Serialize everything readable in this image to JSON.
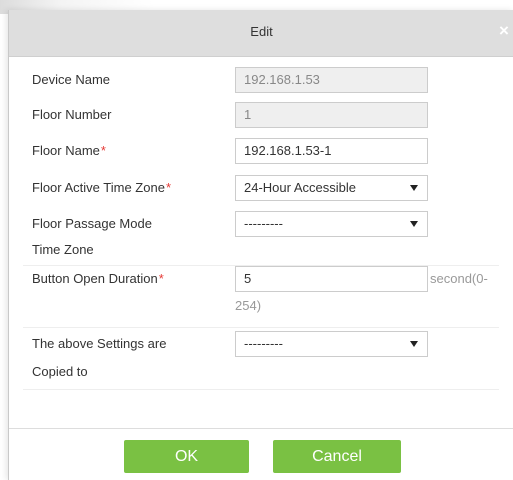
{
  "dialog": {
    "title": "Edit",
    "close_glyph": "×"
  },
  "form": {
    "device_name": {
      "label": "Device Name",
      "value": "192.168.1.53"
    },
    "floor_number": {
      "label": "Floor Number",
      "value": "1"
    },
    "floor_name": {
      "label": "Floor Name",
      "required_mark": "*",
      "value": "192.168.1.53-1"
    },
    "active_time_zone": {
      "label": "Floor Active Time Zone",
      "required_mark": "*",
      "selected": "24-Hour Accessible"
    },
    "passage_mode": {
      "label_line1": "Floor Passage Mode",
      "label_line2": "Time Zone",
      "selected": "---------"
    },
    "open_duration": {
      "label": "Button Open Duration",
      "required_mark": "*",
      "value": "5",
      "unit_line1": "second(0-",
      "unit_line2": "254)"
    },
    "copy_to": {
      "label_line1": "The above Settings are",
      "label_line2": "Copied to",
      "selected": "---------"
    }
  },
  "buttons": {
    "ok": "OK",
    "cancel": "Cancel"
  },
  "colors": {
    "title_bar": "#dedede",
    "button_green": "#7ac143",
    "required_red": "#e53935"
  },
  "icons": {
    "close": "close-icon",
    "dropdown": "chevron-down-icon"
  }
}
